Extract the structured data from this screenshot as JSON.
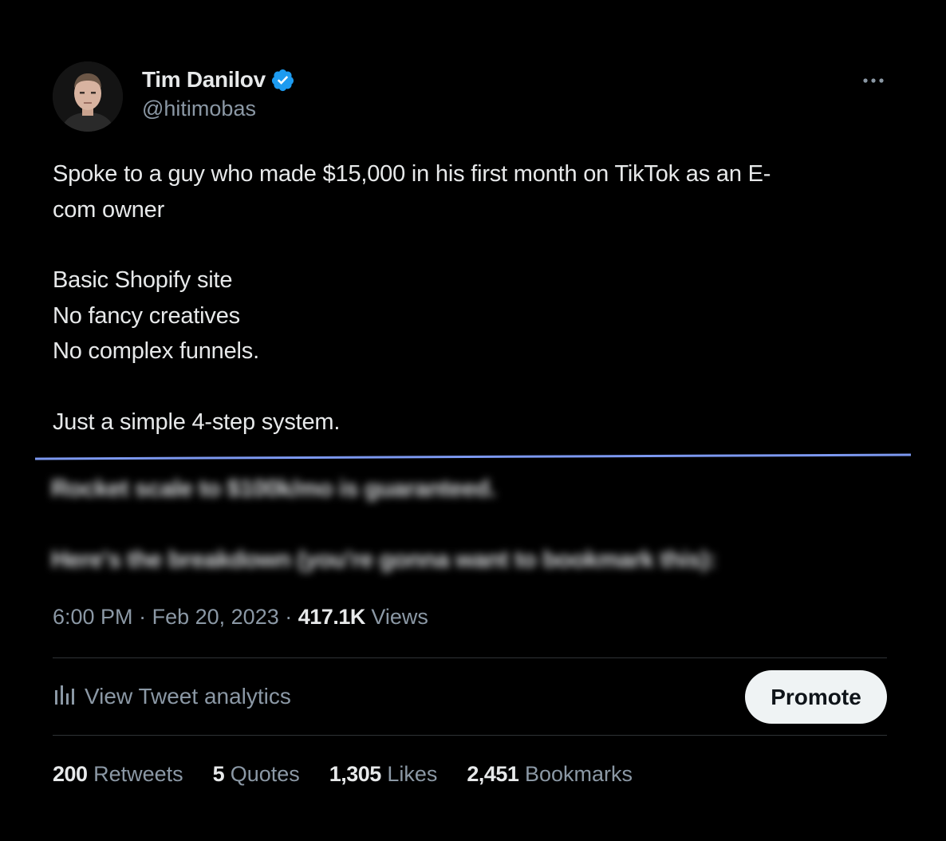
{
  "author": {
    "name": "Tim Danilov",
    "handle": "@hitimobas",
    "verified": true,
    "badge_color": "#1d9bf0",
    "avatar_icon": "profile-photo"
  },
  "more_icon": "ellipsis-icon",
  "tweet": {
    "lines": [
      "Spoke to a guy who made $15,000 in his first month on TikTok as an E-",
      "com owner",
      "Basic Shopify site",
      "No fancy creatives",
      "No complex funnels.",
      "Just a simple 4-step system."
    ],
    "blurred_lines": [
      "Rocket scale to $100k/mo is guaranteed.",
      "Here's the breakdown (you're gonna want to bookmark this):"
    ]
  },
  "meta": {
    "time": "6:00 PM",
    "separator": "·",
    "date": "Feb 20, 2023",
    "views_count": "417.1K",
    "views_label": "Views"
  },
  "analytics": {
    "label": "View Tweet analytics",
    "icon": "bar-chart-icon"
  },
  "promote": {
    "label": "Promote"
  },
  "stats": [
    {
      "count": "200",
      "label": "Retweets"
    },
    {
      "count": "5",
      "label": "Quotes"
    },
    {
      "count": "1,305",
      "label": "Likes"
    },
    {
      "count": "2,451",
      "label": "Bookmarks"
    }
  ],
  "colors": {
    "background": "#000000",
    "text_primary": "#e7e9ea",
    "text_secondary": "#8b98a5",
    "divider": "#2f3336",
    "highlight_line": "#7c98f0",
    "promote_bg": "#eff3f4"
  }
}
